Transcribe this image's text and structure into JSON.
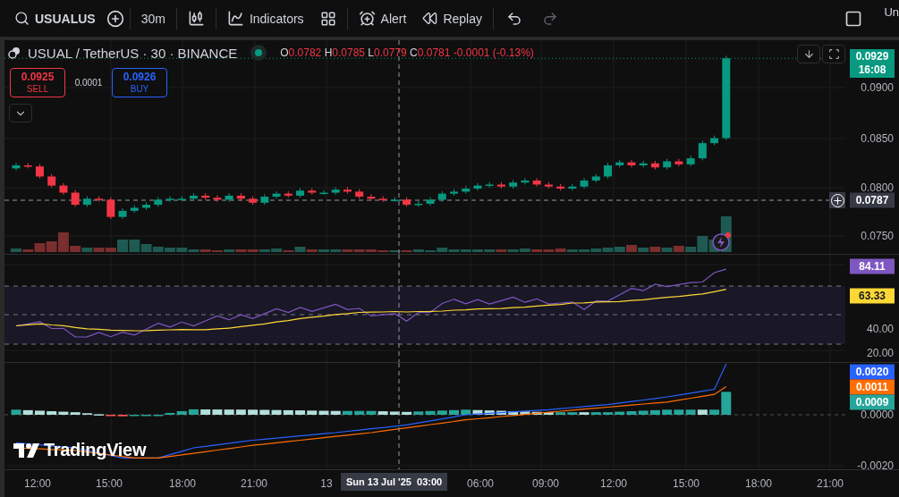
{
  "toolbar": {
    "symbol": "USUALUS",
    "interval": "30m",
    "indicators_label": "Indicators",
    "alert_label": "Alert",
    "replay_label": "Replay",
    "cut_text": "Un"
  },
  "legend": {
    "title": "USUAL / TetherUS · 30 · BINANCE",
    "ohlc": [
      {
        "key": "O",
        "value": "0.0782"
      },
      {
        "key": "H",
        "value": "0.0785"
      },
      {
        "key": "L",
        "value": "0.0779"
      },
      {
        "key": "C",
        "value": "0.0781"
      }
    ],
    "change": "-0.0001 (-0.13%)"
  },
  "order": {
    "sell_price": "0.0925",
    "sell_label": "SELL",
    "spread": "0.0001",
    "buy_price": "0.0926",
    "buy_label": "BUY"
  },
  "price_axis": {
    "ticks": [
      "0.0900",
      "0.0850",
      "0.0800",
      "0.0750"
    ],
    "badges": [
      {
        "kind": "last",
        "text": "0.0929",
        "sub": "16:08",
        "color": "#089981"
      },
      {
        "kind": "crosshair",
        "text": "0.0787",
        "color": "#363a45"
      }
    ]
  },
  "rsi_axis": {
    "ticks": [
      "40.00",
      "20.00"
    ],
    "badges": [
      {
        "text": "84.11",
        "color": "#7e57c2"
      },
      {
        "text": "63.33",
        "color": "#fdd835"
      }
    ]
  },
  "macd_axis": {
    "ticks": [
      "0.0000",
      "-0.0020"
    ],
    "badges": [
      {
        "text": "0.0020",
        "color": "#2962ff"
      },
      {
        "text": "0.0011",
        "color": "#ff6d00"
      },
      {
        "text": "0.0009",
        "color": "#26a69a"
      }
    ]
  },
  "time_axis": {
    "labels": [
      "12:00",
      "15:00",
      "18:00",
      "21:00",
      "13",
      "06:00",
      "09:00",
      "12:00",
      "15:00",
      "18:00",
      "21:00"
    ],
    "crosshair": {
      "date": "Sun 13 Jul '25",
      "time": "03:00"
    }
  },
  "logo": "TradingView"
}
